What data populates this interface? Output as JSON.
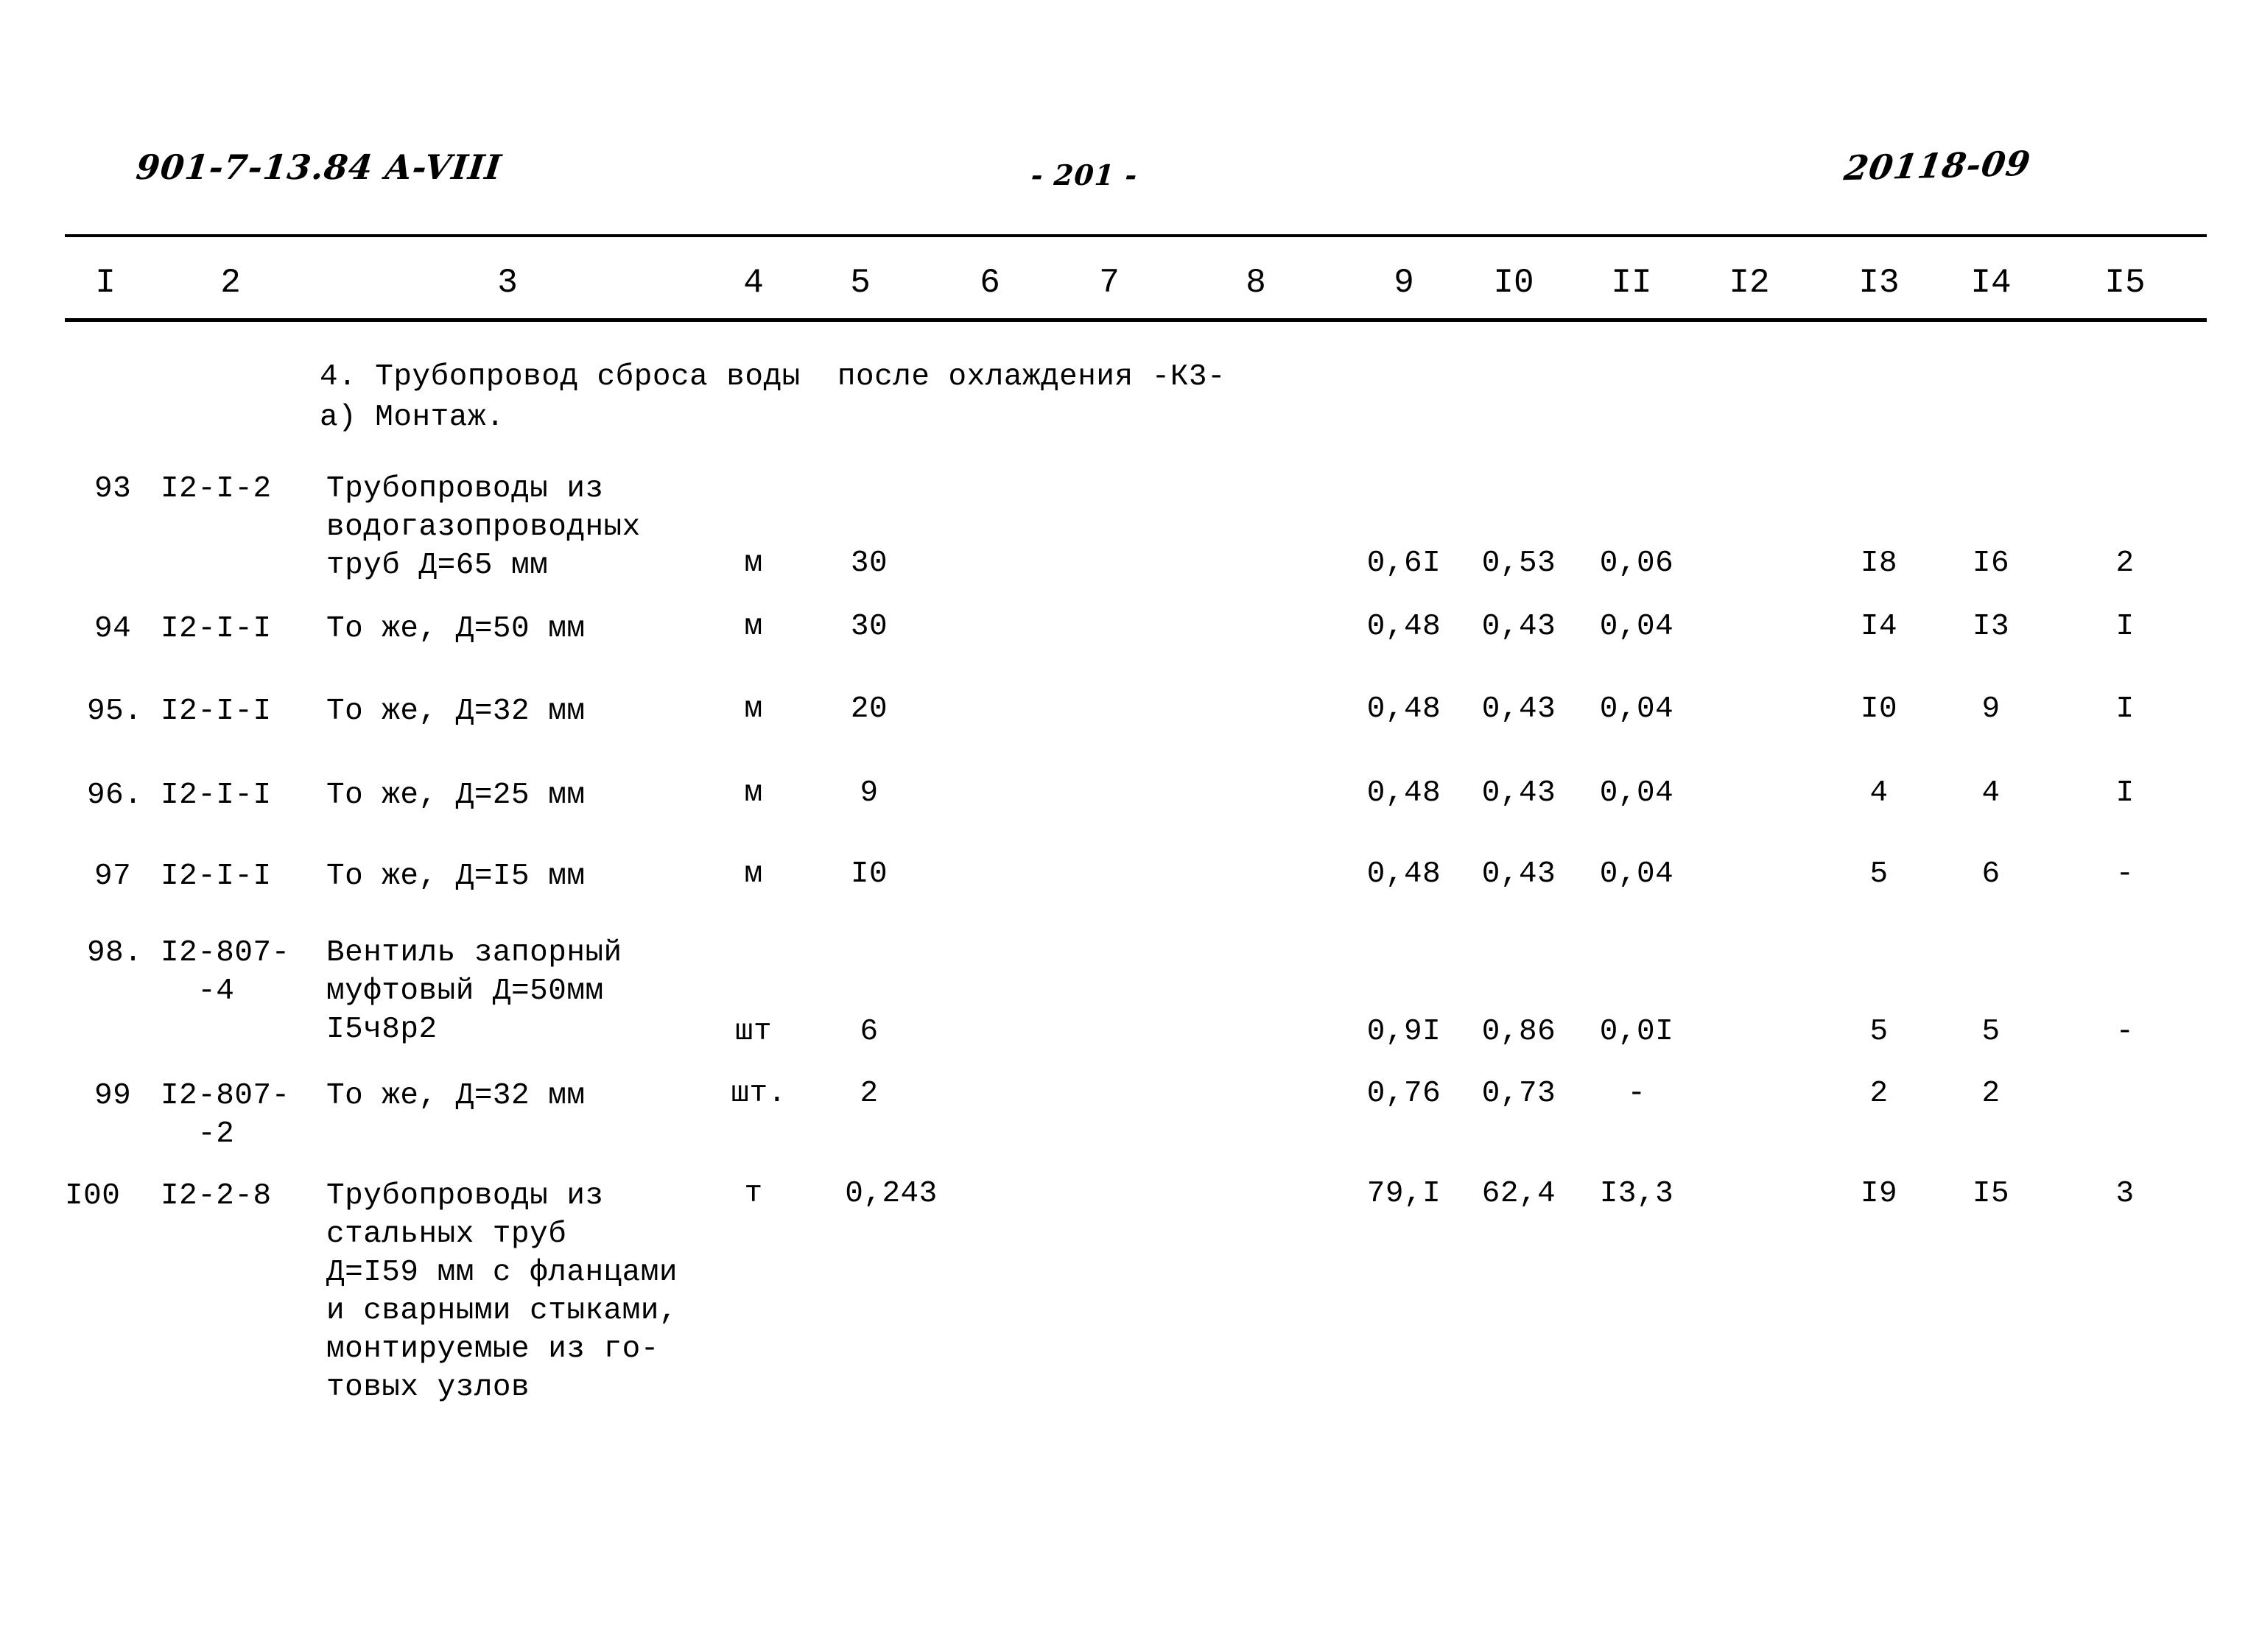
{
  "header": {
    "doc_code": "901-7-13.84  A-VIII",
    "page_number": "- 201 -",
    "order_number": "20118-09"
  },
  "table": {
    "column_headers": [
      "I",
      "2",
      "3",
      "4",
      "5",
      "6",
      "7",
      "8",
      "9",
      "I0",
      "II",
      "I2",
      "I3",
      "I4",
      "I5"
    ],
    "section_title": "4. Трубопровод сброса воды  после охлаждения -К3-",
    "section_subtitle": "а) Монтаж.",
    "rows": [
      {
        "num": "93",
        "code": "I2-I-2",
        "description": "Трубопроводы из\nводогазопроводных\nтруб Д=65 мм",
        "unit": "м",
        "qty": "30",
        "c6": "",
        "c7": "",
        "c8": "",
        "c9": "0,6I",
        "c10": "0,53",
        "c11": "0,06",
        "c12": "",
        "c13": "I8",
        "c14": "I6",
        "c15": "2"
      },
      {
        "num": "94",
        "code": "I2-I-I",
        "description": "То же, Д=50 мм",
        "unit": "м",
        "qty": "30",
        "c6": "",
        "c7": "",
        "c8": "",
        "c9": "0,48",
        "c10": "0,43",
        "c11": "0,04",
        "c12": "",
        "c13": "I4",
        "c14": "I3",
        "c15": "I"
      },
      {
        "num": "95.",
        "code": "I2-I-I",
        "description": "То же, Д=32 мм",
        "unit": "м",
        "qty": "20",
        "c6": "",
        "c7": "",
        "c8": "",
        "c9": "0,48",
        "c10": "0,43",
        "c11": "0,04",
        "c12": "",
        "c13": "I0",
        "c14": "9",
        "c15": "I"
      },
      {
        "num": "96.",
        "code": "I2-I-I",
        "description": "То же, Д=25 мм",
        "unit": "м",
        "qty": "9",
        "c6": "",
        "c7": "",
        "c8": "",
        "c9": "0,48",
        "c10": "0,43",
        "c11": "0,04",
        "c12": "",
        "c13": "4",
        "c14": "4",
        "c15": "I"
      },
      {
        "num": "97",
        "code": "I2-I-I",
        "description": "То же, Д=I5 мм",
        "unit": "м",
        "qty": "I0",
        "c6": "",
        "c7": "",
        "c8": "",
        "c9": "0,48",
        "c10": "0,43",
        "c11": "0,04",
        "c12": "",
        "c13": "5",
        "c14": "6",
        "c15": "-"
      },
      {
        "num": "98.",
        "code": "I2-807-\n  -4",
        "description": "Вентиль запорный\nмуфтовый Д=50мм\nI5ч8р2",
        "unit": "шт",
        "qty": "6",
        "c6": "",
        "c7": "",
        "c8": "",
        "c9": "0,9I",
        "c10": "0,86",
        "c11": "0,0I",
        "c12": "",
        "c13": "5",
        "c14": "5",
        "c15": "-"
      },
      {
        "num": "99",
        "code": "I2-807-\n  -2",
        "description": "То же, Д=32 мм",
        "unit": "шт.",
        "qty": "2",
        "c6": "",
        "c7": "",
        "c8": "",
        "c9": "0,76",
        "c10": "0,73",
        "c11": "-",
        "c12": "",
        "c13": "2",
        "c14": "2",
        "c15": ""
      },
      {
        "num": "I00",
        "code": "I2-2-8",
        "description": "Трубопроводы из\nстальных труб\nД=I59 мм с фланцами\nи сварными стыками,\nмонтируемые из го-\nтовых узлов",
        "unit": "т",
        "qty": "0,243",
        "c6": "",
        "c7": "",
        "c8": "",
        "c9": "79,I",
        "c10": "62,4",
        "c11": "I3,3",
        "c12": "",
        "c13": "I9",
        "c14": "I5",
        "c15": "3"
      }
    ]
  }
}
